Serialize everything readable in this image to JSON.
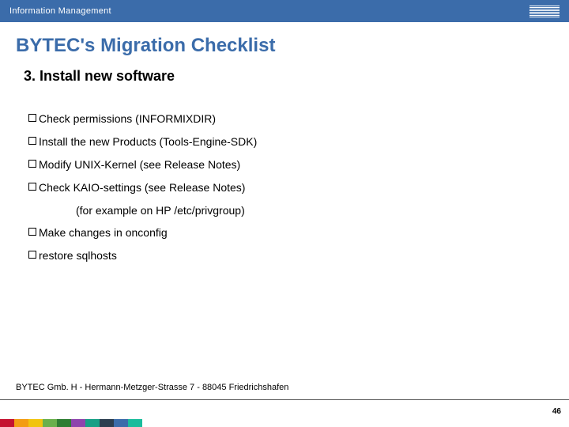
{
  "header": {
    "section": "Information Management"
  },
  "title": "BYTEC's Migration Checklist",
  "section_heading": "3. Install new software",
  "items": [
    "Check permissions (INFORMIXDIR)",
    "Install the new  Products (Tools-Engine-SDK)",
    "Modify UNIX-Kernel (see Release Notes)",
    "Check KAIO-settings (see Release Notes)"
  ],
  "sub_item": "(for example on  HP  /etc/privgroup)",
  "items_after": [
    "Make changes in onconfig",
    "restore sqlhosts"
  ],
  "footer": "BYTEC Gmb. H  -  Hermann-Metzger-Strasse 7   - 88045 Friedrichshafen",
  "page_number": "46",
  "colors": [
    "#c41230",
    "#f39c12",
    "#f1c40f",
    "#6ab04c",
    "#2e7d32",
    "#8e44ad",
    "#16a085",
    "#2c3e50",
    "#3b6caa",
    "#1abc9c"
  ]
}
